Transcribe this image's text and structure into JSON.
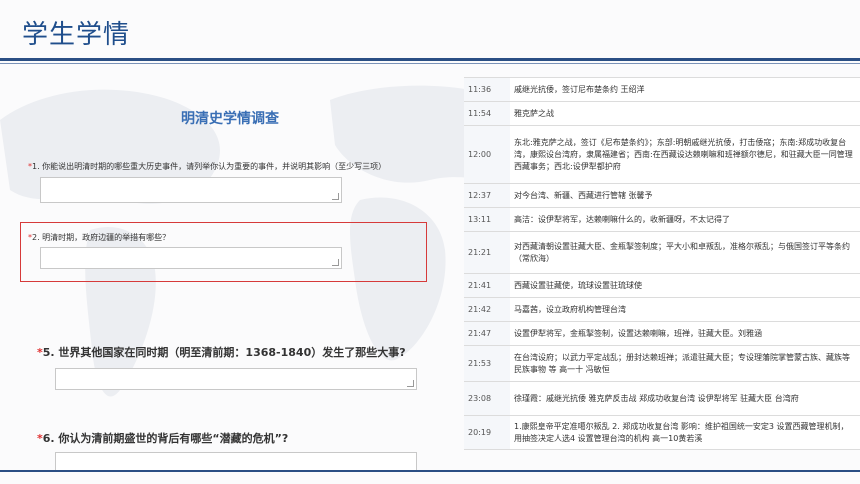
{
  "slide": {
    "title": "学生学情",
    "colors": {
      "title": "#1f4e8c",
      "rule": "#2b4f84",
      "highlight": "#d63a3a",
      "required": "#e03030"
    }
  },
  "survey": {
    "title": "明清史学情调查",
    "questions": [
      {
        "star": "*",
        "text": "1. 你能说出明清时期的哪些重大历史事件，请列举你认为重要的事件，并说明其影响（至少写三项）"
      },
      {
        "star": "*",
        "text": "2. 明清时期，政府边疆的举措有哪些？"
      },
      {
        "star": "*",
        "text": "5. 世界其他国家在同时期（明至清前期：1368-1840）发生了那些大事?"
      },
      {
        "star": "*",
        "text": "6. 你认为清前期盛世的背后有哪些“潜藏的危机”?"
      }
    ]
  },
  "responses": [
    {
      "time": "11:36",
      "text": "戚继光抗倭，签订尼布楚条约 王绍洋"
    },
    {
      "time": "11:54",
      "text": "雅克萨之战"
    },
    {
      "time": "12:00",
      "text": "东北:雅克萨之战，签订《尼布楚条约》；东部:明朝戚继光抗倭，打击倭寇；东南:郑成功收复台湾，康熙设台湾府，隶属福建省；西南:在西藏设达赖喇嘛和班禅额尔德尼，和驻藏大臣一同管理西藏事务；西北:设伊犁都护府"
    },
    {
      "time": "12:37",
      "text": "对今台湾、新疆、西藏进行管辖 张馨予"
    },
    {
      "time": "13:11",
      "text": "高洁：设伊犁将军，达赖喇嘛什么的，收新疆呀，不太记得了"
    },
    {
      "time": "21:21",
      "text": "对西藏清朝设置驻藏大臣、金瓶掣签制度；平大小和卓叛乱，准格尔叛乱；与俄国签订平等条约（常欣海）"
    },
    {
      "time": "21:41",
      "text": "西藏设置驻藏使，琉球设置驻琉球使"
    },
    {
      "time": "21:42",
      "text": "马嘉茜，设立政府机构管理台湾"
    },
    {
      "time": "21:47",
      "text": "设置伊犁将军，金瓶掣签制，设置达赖喇嘛，班禅，驻藏大臣。刘雅涵"
    },
    {
      "time": "21:53",
      "text": "在台湾设府；以武力平定战乱；册封达赖班禅；派遣驻藏大臣；专设理藩院掌管蒙古族、藏族等民族事物 等 高一十 冯敏恒"
    },
    {
      "time": "23:08",
      "text": "徐瑾霞：戚继光抗倭 雅克萨反击战 郑成功收复台湾 设伊犁将军 驻藏大臣 台湾府"
    },
    {
      "time": "20:19",
      "text": "1.康熙皇帝平定准噶尔叛乱 2. 郑成功收复台湾 影响：维护祖国统一安定3 设置西藏管理机制，用抽签决定人选4 设置管理台湾的机构 高一10黄若溪"
    }
  ]
}
